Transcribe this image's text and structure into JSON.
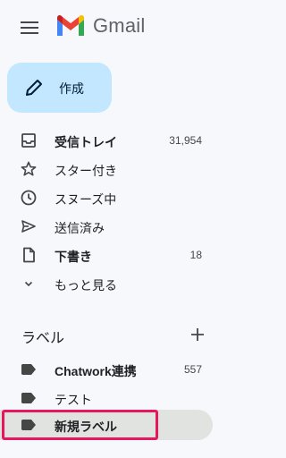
{
  "app": {
    "logo_text": "Gmail"
  },
  "compose": {
    "label": "作成"
  },
  "nav": [
    {
      "label": "受信トレイ",
      "count": "31,954",
      "icon": "inbox-icon"
    },
    {
      "label": "スター付き",
      "count": "",
      "icon": "star-icon"
    },
    {
      "label": "スヌーズ中",
      "count": "",
      "icon": "clock-icon"
    },
    {
      "label": "送信済み",
      "count": "",
      "icon": "send-icon"
    },
    {
      "label": "下書き",
      "count": "18",
      "icon": "draft-icon"
    },
    {
      "label": "もっと見る",
      "count": "",
      "icon": "chevron-down-icon"
    }
  ],
  "labels_section": {
    "title": "ラベル",
    "items": [
      {
        "label": "Chatwork連携",
        "count": "557"
      },
      {
        "label": "テスト",
        "count": ""
      },
      {
        "label": "新規ラベル",
        "count": ""
      }
    ]
  },
  "colors": {
    "compose_bg": "#c2e7ff",
    "highlight_border": "#e8175d",
    "active_bg": "#e1e3e1",
    "page_bg": "#f6f8fc"
  }
}
